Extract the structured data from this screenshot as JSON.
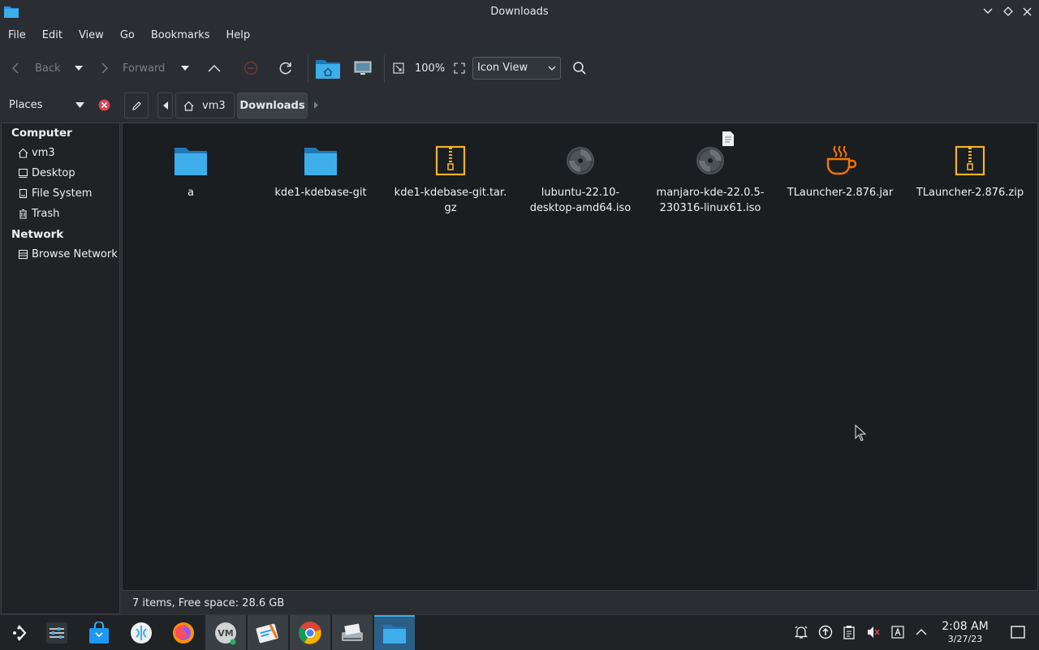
{
  "window": {
    "title": "Downloads"
  },
  "menu": [
    "File",
    "Edit",
    "View",
    "Go",
    "Bookmarks",
    "Help"
  ],
  "toolbar": {
    "back_label": "Back",
    "forward_label": "Forward",
    "zoom": "100%",
    "view_mode": "Icon View"
  },
  "places": {
    "label": "Places"
  },
  "breadcrumb": {
    "home": "vm3",
    "current": "Downloads"
  },
  "sidebar": {
    "computer_header": "Computer",
    "computer_items": [
      "vm3",
      "Desktop",
      "File System",
      "Trash"
    ],
    "network_header": "Network",
    "network_items": [
      "Browse Network"
    ]
  },
  "files": [
    {
      "name": "a",
      "icon": "folder-icon"
    },
    {
      "name": "kde1-kdebase-git",
      "icon": "folder-icon"
    },
    {
      "name": "kde1-kdebase-git.tar.\ngz",
      "icon": "archive-icon"
    },
    {
      "name": "lubuntu-22.10-\ndesktop-amd64.iso",
      "icon": "disc-image-icon"
    },
    {
      "name": "manjaro-kde-22.0.5-\n230316-linux61.iso",
      "icon": "disc-image-icon"
    },
    {
      "name": "TLauncher-2.876.jar",
      "icon": "java-icon"
    },
    {
      "name": "TLauncher-2.876.zip",
      "icon": "archive-icon"
    }
  ],
  "status": "7 items, Free space: 28.6 GB",
  "clock": {
    "time": "2:08 AM",
    "date": "3/27/23"
  },
  "colors": {
    "accent": "#3daee9",
    "folder": "#3daee9",
    "archive": "#f0b429",
    "java": "#f67400"
  }
}
